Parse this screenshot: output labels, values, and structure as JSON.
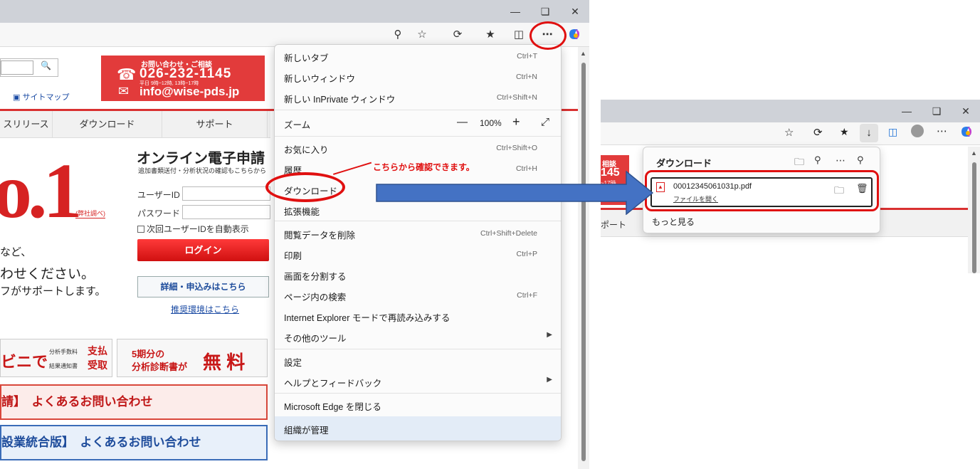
{
  "left": {
    "page": {
      "sitemap": "サイトマップ",
      "contact": {
        "heading": "お問い合わせ・ご相談",
        "phone": "026-232-1145",
        "hours": "平日 9時~12時, 13時~17時",
        "email": "info@wise-pds.jp"
      },
      "nav": [
        "スリリース",
        "ダウンロード",
        "サポート"
      ],
      "hero_big": "o.1",
      "hero_note": "(弊社調べ)",
      "online_title": "オンライン電子申請",
      "online_sub": "追加書類送付・分析状況の確認もこちらから",
      "userid_label": "ユーザーID",
      "password_label": "パスワード",
      "remember": "次回ユーザーIDを自動表示",
      "login": "ログイン",
      "detail": "詳細・申込みはこちら",
      "env_link": "推奨環境はこちら",
      "text1": "など、",
      "text2": "わせください。",
      "text3": "フがサポートします。",
      "banner1_main": "ビニで",
      "banner1_small1": "分析手数料",
      "banner1_small2": "結果通知書",
      "banner1_red1": "支払",
      "banner1_red2": "受取",
      "banner2_line1": "5期分の",
      "banner2_line2": "分析診断書が",
      "banner2_free": "無 料",
      "faq1": "請】　よくあるお問い合わせ",
      "faq2": "設業統合版】　よくあるお問い合わせ"
    },
    "menu": {
      "items": [
        {
          "label": "新しいタブ",
          "shortcut": "Ctrl+T"
        },
        {
          "label": "新しいウィンドウ",
          "shortcut": "Ctrl+N"
        },
        {
          "label": "新しい InPrivate ウィンドウ",
          "shortcut": "Ctrl+Shift+N"
        },
        {
          "label": "ズーム",
          "shortcut": ""
        },
        {
          "label": "お気に入り",
          "shortcut": "Ctrl+Shift+O"
        },
        {
          "label": "履歴",
          "shortcut": "Ctrl+H"
        },
        {
          "label": "ダウンロード",
          "shortcut": ""
        },
        {
          "label": "拡張機能",
          "shortcut": ""
        },
        {
          "label": "閲覧データを削除",
          "shortcut": "Ctrl+Shift+Delete"
        },
        {
          "label": "印刷",
          "shortcut": "Ctrl+P"
        },
        {
          "label": "画面を分割する",
          "shortcut": ""
        },
        {
          "label": "ページ内の検索",
          "shortcut": "Ctrl+F"
        },
        {
          "label": "Internet Explorer モードで再読み込みする",
          "shortcut": ""
        },
        {
          "label": "その他のツール",
          "shortcut": ""
        },
        {
          "label": "設定",
          "shortcut": ""
        },
        {
          "label": "ヘルプとフィードバック",
          "shortcut": ""
        },
        {
          "label": "Microsoft Edge を閉じる",
          "shortcut": ""
        },
        {
          "label": "組織が管理",
          "shortcut": ""
        }
      ],
      "zoom_value": "100%",
      "zoom_minus": "—",
      "zoom_plus": "+"
    },
    "annotation": "こちらから確認できます。"
  },
  "right": {
    "page_strip": [
      "相談",
      "145",
      "~17時"
    ],
    "nav": "ポート",
    "downloads": {
      "title": "ダウンロード",
      "file_name": "00012345061031p.pdf",
      "open_file": "ファイルを開く",
      "see_more": "もっと見る"
    }
  },
  "icons": {
    "minimize": "minimize-icon",
    "restore": "restore-icon",
    "close": "close-icon",
    "more": "more-icon",
    "copilot": "copilot-icon"
  },
  "colors": {
    "accent_red": "#e01010",
    "arrow_blue": "#4472c4",
    "brand_red": "#d93030"
  }
}
